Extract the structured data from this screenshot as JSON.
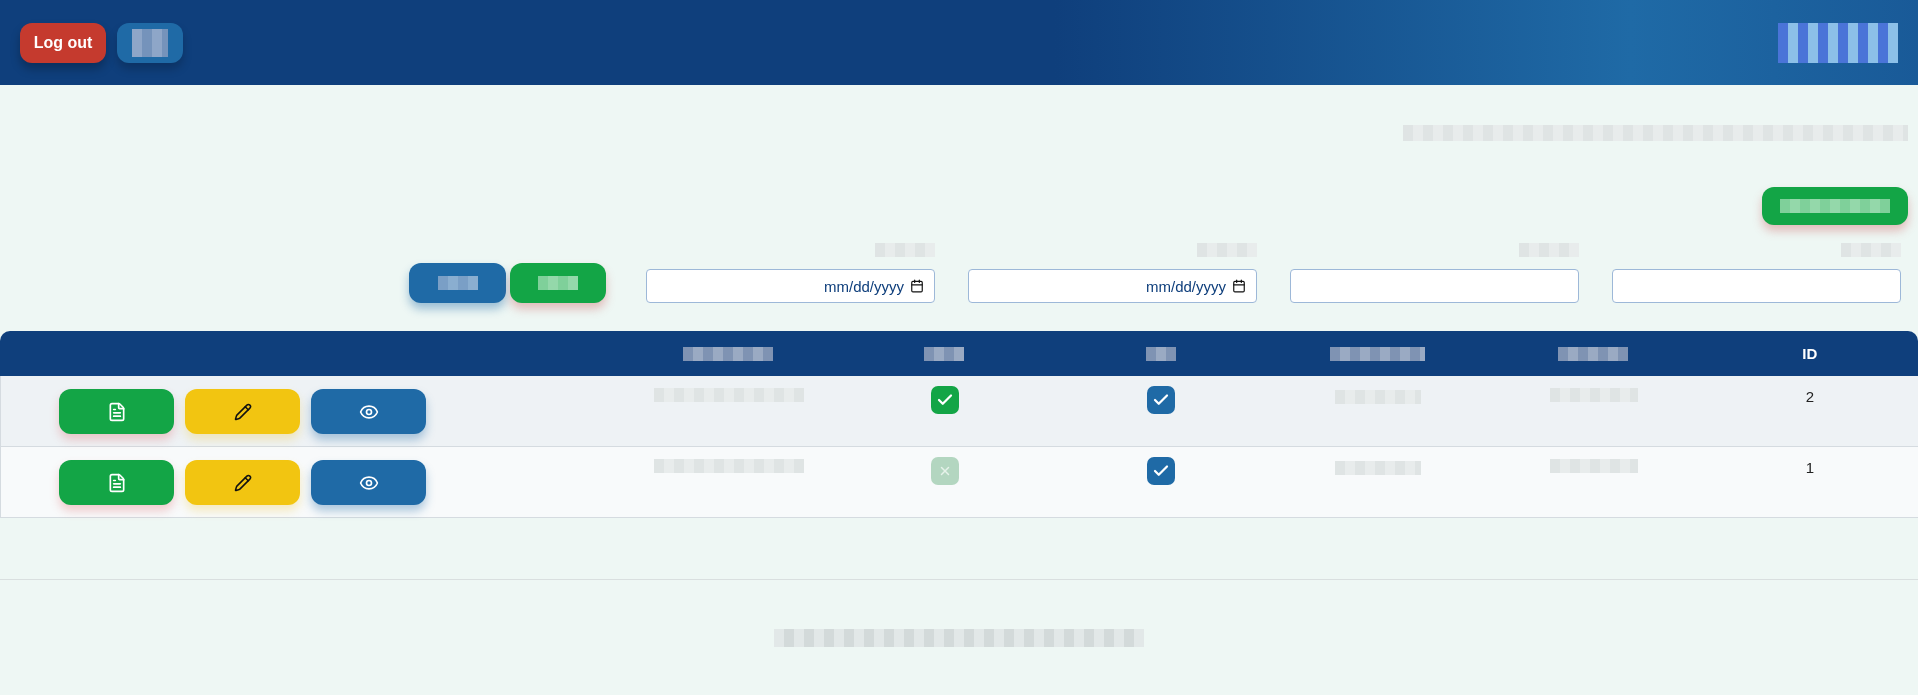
{
  "header": {
    "logout_button": {
      "label": "Log out"
    }
  },
  "filters": {
    "date_fields": [
      {
        "placeholder": "mm/dd/yyyy"
      },
      {
        "placeholder": "mm/dd/yyyy"
      }
    ]
  },
  "table": {
    "last_column": {
      "label": "ID"
    },
    "rows": [
      {
        "id": "2",
        "column_3_checked": true,
        "column_4_checked": true
      },
      {
        "id": "1",
        "column_3_checked": false,
        "column_4_checked": true
      }
    ]
  }
}
